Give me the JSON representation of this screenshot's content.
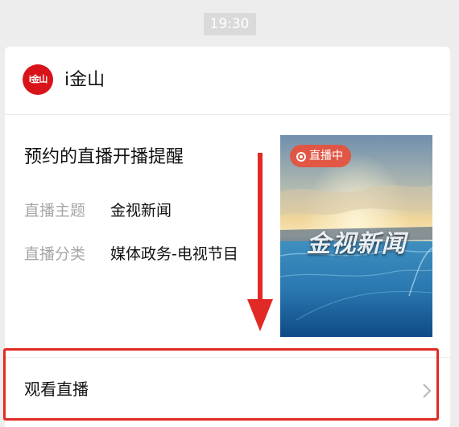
{
  "chat": {
    "timestamp": "19:30"
  },
  "card": {
    "account": {
      "logo_icon": "jinshan-logo-icon",
      "logo_text": "i金山",
      "name": "i金山"
    },
    "title": "预约的直播开播提醒",
    "fields": [
      {
        "label": "直播主题",
        "value": "金视新闻"
      },
      {
        "label": "直播分类",
        "value": "媒体政务-电视节目"
      }
    ],
    "thumbnail": {
      "badge": "直播中",
      "badge_icon": "live-record-icon",
      "text": "金视新闻"
    },
    "action": {
      "label": "观看直播",
      "icon": "chevron-right-icon"
    }
  },
  "colors": {
    "background": "#ededed",
    "card": "#ffffff",
    "brand_red": "#d8131a",
    "label_gray": "#a7a7a7",
    "annotation_red": "#e12a25"
  }
}
